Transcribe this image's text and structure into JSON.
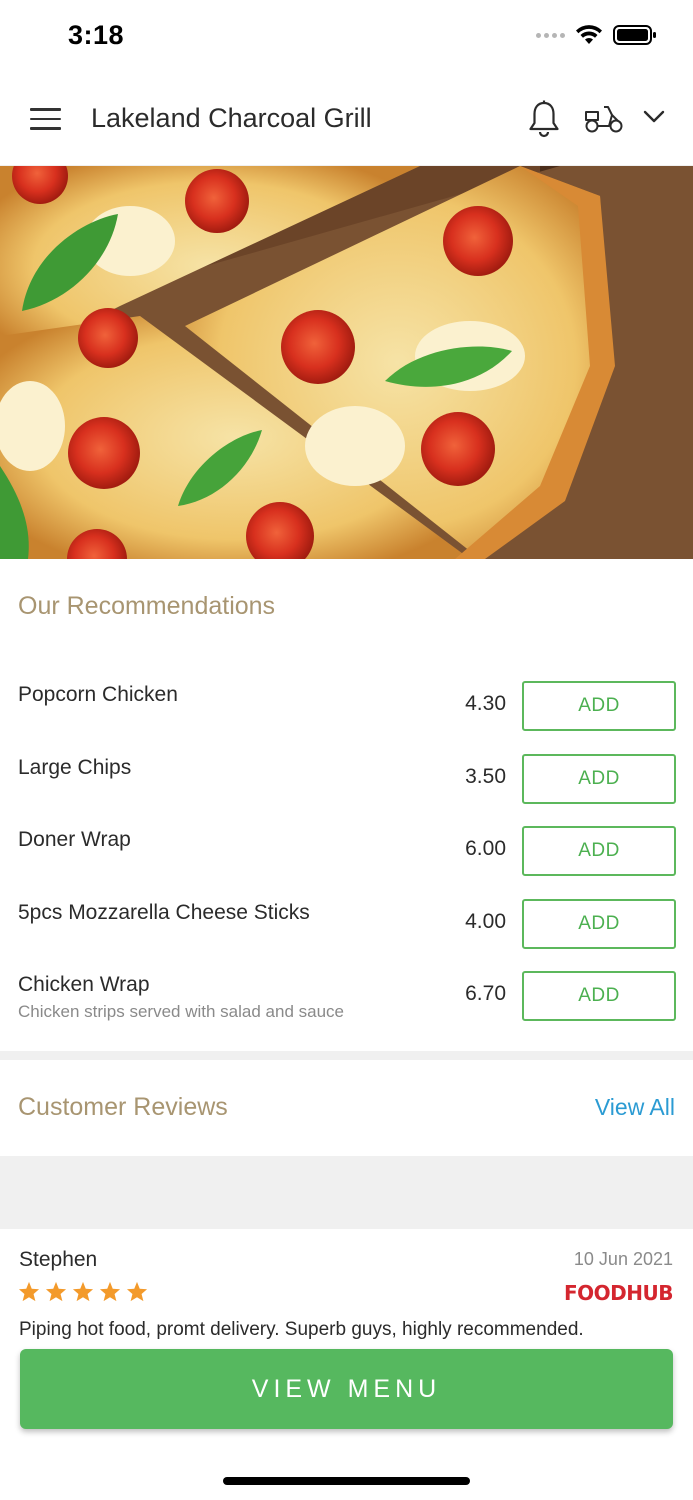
{
  "status_bar": {
    "time": "3:18"
  },
  "header": {
    "title": "Lakeland Charcoal Grill"
  },
  "recommendations": {
    "title": "Our Recommendations",
    "items": [
      {
        "name": "Popcorn Chicken",
        "price": "4.30",
        "button": "ADD"
      },
      {
        "name": "Large Chips",
        "price": "3.50",
        "button": "ADD"
      },
      {
        "name": "Doner Wrap",
        "price": "6.00",
        "button": "ADD"
      },
      {
        "name": "5pcs Mozzarella Cheese Sticks",
        "price": "4.00",
        "button": "ADD"
      },
      {
        "name": "Chicken Wrap",
        "description": "Chicken strips served with salad and sauce",
        "price": "6.70",
        "button": "ADD"
      }
    ]
  },
  "reviews": {
    "title": "Customer Reviews",
    "view_all": "View All",
    "items": [
      {
        "name": "Stephen",
        "date": "10 Jun 2021",
        "rating": 5,
        "source": "FOODHUB",
        "text": "Piping hot food, promt delivery. Superb guys, highly recommended."
      }
    ]
  },
  "cta": {
    "label": "VIEW MENU"
  },
  "colors": {
    "accent_green": "#56b85f",
    "section_title": "#a89571",
    "link_blue": "#2b9bd3",
    "star": "#f39a2b",
    "foodhub_red": "#d4262f"
  }
}
